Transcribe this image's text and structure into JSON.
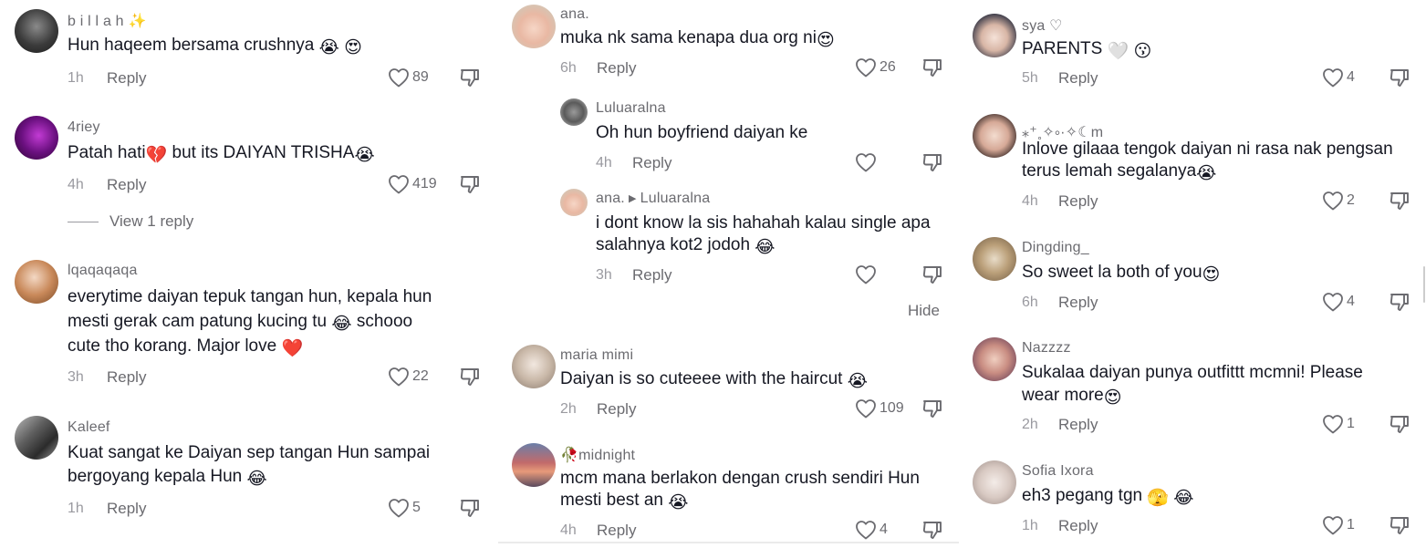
{
  "columns": [
    {
      "comments": [
        {
          "user": "b i l l a h",
          "user_emoji": "✨",
          "text": "Hun haqeem bersama crushnya",
          "text_emoji": "😭 😍",
          "time": "1h",
          "reply": "Reply",
          "likes": "89",
          "avatar_icon": "avatar-dark"
        },
        {
          "user": "4riey",
          "text": "Patah hati",
          "text_emoji_mid": "💔",
          "text_after": " but its DAIYAN TRISHA",
          "text_emoji": "😭",
          "time": "4h",
          "reply": "Reply",
          "likes": "419",
          "view_replies": "View 1 reply",
          "avatar_icon": "avatar-purple"
        },
        {
          "user": "lqaqaqaqa",
          "lines": [
            "everytime daiyan tepuk tangan hun, kepala hun",
            "mesti gerak cam patung kucing tu",
            "cute tho korang. Major love"
          ],
          "line2_emoji": "😂",
          "line2_after": " schooo",
          "line3_emoji": "❤️",
          "time": "3h",
          "reply": "Reply",
          "likes": "22",
          "avatar_icon": "avatar-orange"
        },
        {
          "user": "Kaleef",
          "lines": [
            "Kuat sangat ke Daiyan sep tangan Hun sampai",
            "bergoyang kepala Hun"
          ],
          "line2_emoji": "😂",
          "time": "1h",
          "reply": "Reply",
          "likes": "5",
          "avatar_icon": "avatar-group"
        }
      ]
    },
    {
      "comments": [
        {
          "user": "ana.",
          "text": "muka nk sama kenapa dua org ni",
          "text_emoji": "😍",
          "time": "6h",
          "reply": "Reply",
          "likes": "26",
          "avatar_icon": "avatar-hijab"
        },
        {
          "user": "Luluaralna",
          "text": "Oh hun boyfriend daiyan ke",
          "time": "4h",
          "reply": "Reply",
          "likes": "",
          "avatar_icon": "avatar-cat"
        },
        {
          "user": "ana.",
          "reply_to": "Luluaralna",
          "lines": [
            "i dont know la sis hahahah kalau single apa",
            "salahnya kot2 jodoh"
          ],
          "line2_emoji": "😂",
          "time": "3h",
          "reply": "Reply",
          "likes": "",
          "avatar_icon": "avatar-hijab"
        },
        {
          "hide": "Hide"
        },
        {
          "user": "maria mimi",
          "text": "Daiyan is so cuteeee with the haircut",
          "text_emoji": "😭",
          "time": "2h",
          "reply": "Reply",
          "likes": "109",
          "avatar_icon": "avatar-light"
        },
        {
          "user": "midnight",
          "user_emoji": "🥀",
          "lines": [
            "mcm mana berlakon dengan crush sendiri Hun",
            "mesti best an"
          ],
          "line2_emoji": "😭",
          "time": "4h",
          "reply": "Reply",
          "likes": "4",
          "avatar_icon": "avatar-sunset"
        }
      ]
    },
    {
      "comments": [
        {
          "user": "sya ♡",
          "text": "PARENTS",
          "text_emoji": "🤍 😗",
          "time": "5h",
          "reply": "Reply",
          "likes": "4",
          "avatar_icon": "avatar-girl"
        },
        {
          "user": "⁎⁺˳✧༚·✧☾m",
          "lines": [
            "Inlove gilaaa tengok daiyan ni rasa nak pengsan",
            "terus lemah segalanya"
          ],
          "line2_emoji": "😭",
          "time": "4h",
          "reply": "Reply",
          "likes": "2",
          "avatar_icon": "avatar-girl2"
        },
        {
          "user": "Dingding_",
          "text": "So sweet la both of you",
          "text_emoji": "😍",
          "time": "6h",
          "reply": "Reply",
          "likes": "4",
          "avatar_icon": "avatar-cat2"
        },
        {
          "user": "Nazzzz",
          "lines": [
            "Sukalaa daiyan punya outfittt mcmni! Please",
            "wear more"
          ],
          "line2_emoji": "😍",
          "time": "2h",
          "reply": "Reply",
          "likes": "1",
          "avatar_icon": "avatar-hijab2"
        },
        {
          "user": "Sofia Ixora",
          "text": "eh3 pegang tgn",
          "text_emoji": "🫣 😂",
          "time": "1h",
          "reply": "Reply",
          "likes": "1",
          "avatar_icon": "avatar-cartoon"
        }
      ]
    }
  ],
  "colors": {
    "text": "#161823",
    "muted": "#6b6b70",
    "time": "#9a9aa0"
  }
}
